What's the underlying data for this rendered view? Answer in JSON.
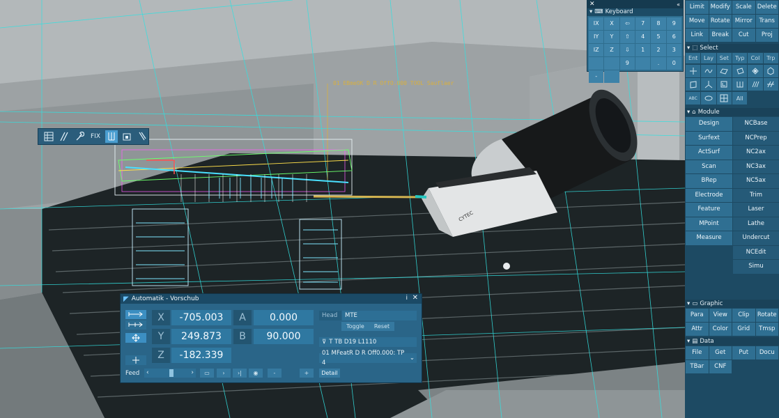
{
  "keyboard": {
    "title": "Keyboard",
    "keys": [
      "IX",
      "X",
      "⇦",
      "7",
      "8",
      "9",
      "IY",
      "Y",
      "⇧",
      "4",
      "5",
      "6",
      "IZ",
      "Z",
      "⇩",
      "1",
      "2",
      "3",
      "",
      "",
      "9",
      "",
      ".",
      "0",
      "-",
      ""
    ]
  },
  "rpanel": {
    "top_buttons": [
      "Limit",
      "Modify",
      "Scale",
      "Delete",
      "Move",
      "Rotate",
      "Mirror",
      "Trans",
      "Link",
      "Break",
      "Cut",
      "Proj"
    ],
    "select": {
      "title": "Select",
      "tabs": [
        "Ent",
        "Lay",
        "Set",
        "Typ",
        "Col",
        "Trp"
      ],
      "all": "All",
      "abc": "ABC"
    },
    "module": {
      "title": "Module",
      "left": [
        "Design",
        "Surfext",
        "ActSurf",
        "Scan",
        "BRep",
        "Electrode",
        "Feature",
        "MPoint",
        "Measure"
      ],
      "right": [
        "NCBase",
        "NCPrep",
        "NC2ax",
        "NC3ax",
        "NC5ax",
        "Trim",
        "Laser",
        "Lathe",
        "Undercut",
        "NCEdit",
        "Simu"
      ]
    },
    "graphic": {
      "title": "Graphic",
      "buttons": [
        "Para",
        "View",
        "Clip",
        "Rotate",
        "Attr",
        "Color",
        "Grid",
        "Tmsp"
      ]
    },
    "data": {
      "title": "Data",
      "buttons": [
        "File",
        "Get",
        "Put",
        "Docu",
        "TBar",
        "CNF"
      ]
    }
  },
  "toolbar": {
    "fix_label": "FIX"
  },
  "viewport": {
    "annotation": "01 EBmeOK D R OffO.000 TOOL Sauflaer"
  },
  "dialog": {
    "title": "Automatik - Vorschub",
    "axes": [
      {
        "name": "X",
        "value": "-705.003"
      },
      {
        "name": "Y",
        "value": "249.873"
      },
      {
        "name": "Z",
        "value": "-182.339"
      }
    ],
    "rot": [
      {
        "name": "A",
        "value": "0.000"
      },
      {
        "name": "B",
        "value": "90.000"
      }
    ],
    "head_label": "Head",
    "head_value": "MTE",
    "toggle": "Toggle",
    "reset": "Reset",
    "tool": "T TB D19 L1110",
    "op": "01 MFeatR D R Off0.000: TP 4",
    "feed_label": "Feed",
    "detail": "Detail",
    "minus": "-",
    "plus": "+",
    "i_icon": "i"
  }
}
